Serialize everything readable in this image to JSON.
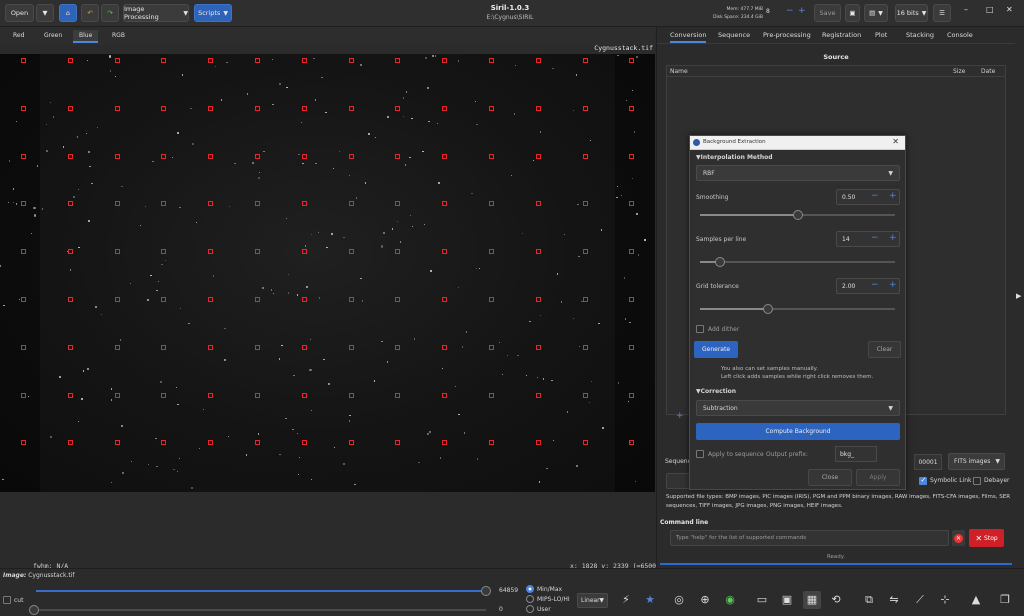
{
  "header": {
    "open_label": "Open",
    "image_processing_label": "Image Processing",
    "scripts_label": "Scripts",
    "app_title": "Siril-1.0.3",
    "path": "E:\\Cygnus\\SIRIL",
    "mem": "Mem: 477.7 MiB",
    "disk": "Disk Space: 234.4 GiB",
    "zoom_value": "8",
    "save_label": "Save",
    "bits_label": "16 bits"
  },
  "channel_tabs": [
    "Red",
    "Green",
    "Blue",
    "RGB"
  ],
  "active_channel": "Blue",
  "viewport": {
    "filename": "Cygnusstack.tif",
    "fwhm": "fwhm: N/A",
    "coords": "x: 1828 y: 2339 (=6500)"
  },
  "right_tabs": [
    "Conversion",
    "Sequence",
    "Pre-processing",
    "Registration",
    "Plot",
    "Stacking",
    "Console"
  ],
  "active_right_tab": "Conversion",
  "conversion": {
    "source_title": "Source",
    "col_name": "Name",
    "col_size": "Size",
    "col_date": "Date",
    "sequence_label": "Sequence",
    "start_index": "00001",
    "output_format": "FITS images",
    "symbolic_link_label": "Symbolic Link",
    "symbolic_link_checked": true,
    "debayer_label": "Debayer",
    "debayer_checked": false,
    "supported_types": "Supported file types: BMP images, PIC images (IRIS), PGM and PPM binary images, RAW images, FITS-CFA images, Films, SER sequences, TIFF images, JPG images, PNG images, HEIF images."
  },
  "command_line": {
    "title": "Command line",
    "placeholder": "Type \"help\" for the list of supported commands",
    "stop_label": "Stop",
    "status": "Ready."
  },
  "dialog": {
    "title": "Background Extraction",
    "interp_section": "Interpolation Method",
    "interp_value": "RBF",
    "smoothing_label": "Smoothing",
    "smoothing_value": "0.50",
    "smoothing_level": 0.5,
    "samples_label": "Samples per line",
    "samples_value": "14",
    "samples_level": 0.1,
    "tolerance_label": "Grid tolerance",
    "tolerance_value": "2.00",
    "tolerance_level": 0.35,
    "add_dither_label": "Add dither",
    "generate_label": "Generate",
    "clear_label": "Clear",
    "hint_line1": "You also can set samples manually.",
    "hint_line2": "Left click adds samples while right click removes them.",
    "correction_section": "Correction",
    "correction_value": "Subtraction",
    "compute_label": "Compute Background",
    "apply_seq_label": "Apply to sequence",
    "output_prefix_label": "Output prefix:",
    "output_prefix_value": "bkg_",
    "close_label": "Close",
    "apply_label": "Apply"
  },
  "bottom": {
    "image_label": "Image:",
    "image_name": "Cygnusstack.tif",
    "cut_label": "cut",
    "high_value": "64859",
    "low_value": "0",
    "radio_minmax": "Min/Max",
    "radio_mips": "MIPS-LO/HI",
    "radio_user": "User",
    "stretch_label": "Linear"
  },
  "tool_icons": [
    "auto-stretch-icon",
    "photometry-icon",
    "zoom-fit-icon",
    "globe-icon",
    "target-icon",
    "keyboard-icon",
    "snapshot-icon",
    "histogram-icon",
    "rotate-icon",
    "crop-icon",
    "flip-icon",
    "plot-icon",
    "align-icon",
    "stats-icon",
    "windows-icon"
  ]
}
